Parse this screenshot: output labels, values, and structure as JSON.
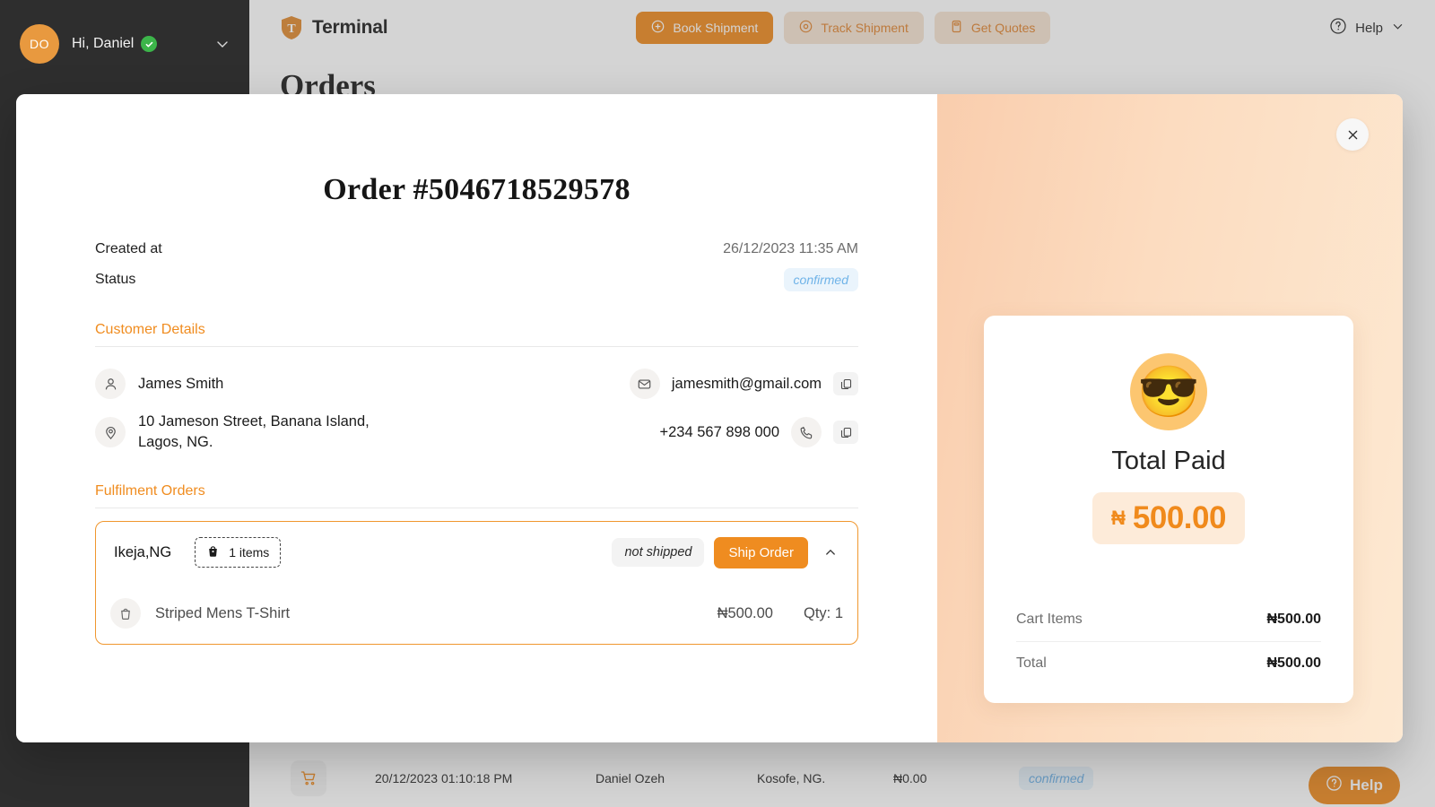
{
  "sidebar": {
    "avatar_initials": "DO",
    "greeting": "Hi, Daniel",
    "verified_icon": "check-badge-icon",
    "chevron_icon": "chevron-down-icon"
  },
  "topbar": {
    "brand": "Terminal",
    "brand_logo_icon": "shield-t-logo",
    "actions": [
      {
        "label": "Book Shipment",
        "icon": "plus-circle-icon",
        "style": "primary"
      },
      {
        "label": "Track Shipment",
        "icon": "location-pin-icon",
        "style": "ghost"
      },
      {
        "label": "Get Quotes",
        "icon": "calculator-icon",
        "style": "ghost"
      }
    ],
    "help_label": "Help",
    "help_icon": "question-circle-icon",
    "help_chevron_icon": "chevron-down-icon"
  },
  "page": {
    "title": "Orders"
  },
  "background_row": {
    "cart_icon": "shopping-cart-icon",
    "date": "20/12/2023 01:10:18 PM",
    "customer": "Daniel Ozeh",
    "location": "Kosofe, NG.",
    "amount": "₦0.00",
    "status": "confirmed"
  },
  "help_fab": {
    "label": "Help",
    "icon": "question-circle-icon"
  },
  "modal": {
    "close_icon": "close-icon",
    "title": "Order #5046718529578",
    "meta": [
      {
        "key": "Created at",
        "value": "26/12/2023 11:35 AM"
      }
    ],
    "status_key": "Status",
    "status_value": "confirmed",
    "customer_section": {
      "title": "Customer Details",
      "name": "James Smith",
      "name_icon": "user-icon",
      "address_line1": "10 Jameson Street, Banana Island,",
      "address_line2": "Lagos, NG.",
      "address_icon": "location-pin-icon",
      "email": "jamesmith@gmail.com",
      "email_icon": "envelope-icon",
      "email_copy_icon": "copy-icon",
      "phone": "+234 567 898 000",
      "phone_icon": "phone-icon",
      "phone_copy_icon": "copy-icon"
    },
    "fulfilment_section": {
      "title": "Fulfilment Orders",
      "location": "Ikeja,NG",
      "items_count": "1 items",
      "items_icon": "shopping-bag-icon",
      "shipping_status": "not shipped",
      "ship_button": "Ship Order",
      "collapse_icon": "chevron-up-icon",
      "items": [
        {
          "icon": "shopping-bag-icon",
          "name": "Striped Mens T-Shirt",
          "price": "₦500.00",
          "qty": "Qty: 1"
        }
      ]
    },
    "summary": {
      "emoji": "😎",
      "paid_label": "Total Paid",
      "paid_currency": "₦",
      "paid_amount": "500.00",
      "rows": [
        {
          "key": "Cart Items",
          "value": "₦500.00"
        },
        {
          "key": "Total",
          "value": "₦500.00"
        }
      ]
    }
  },
  "colors": {
    "brand_orange": "#ee8b22",
    "sidebar_dark": "#2e2e2e",
    "status_blue": "#6fb3e8",
    "panel_gradient_from": "#f9cdad",
    "panel_gradient_to": "#fde9d2"
  }
}
